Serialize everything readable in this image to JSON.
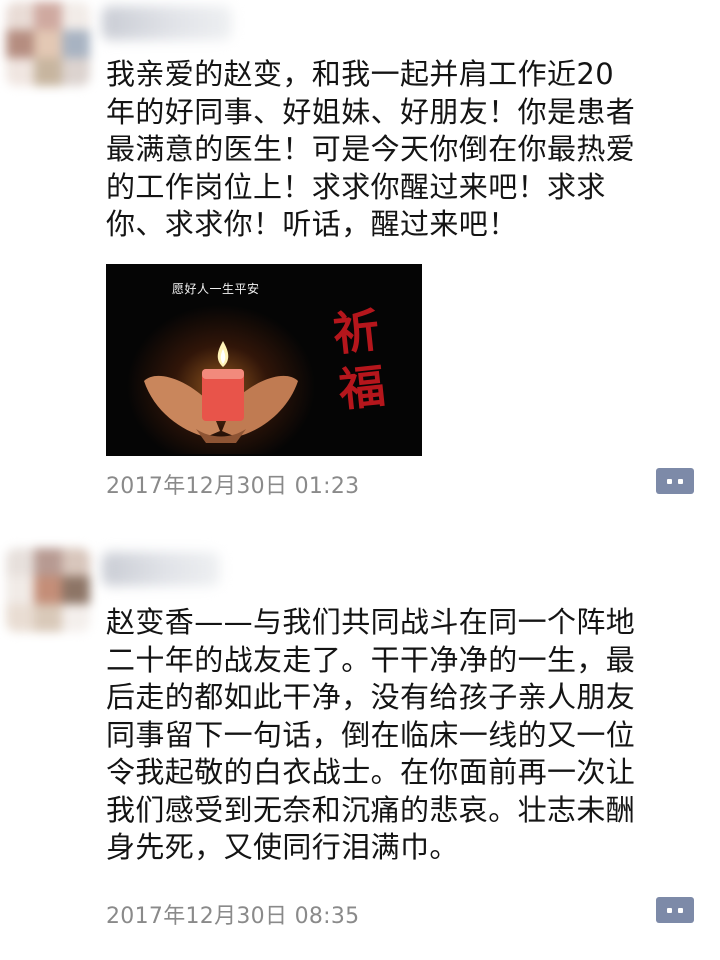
{
  "posts": [
    {
      "text": "我亲爱的赵变，和我一起并肩工作近20\n年的好同事、好姐妹、好朋友！你是患者\n最满意的医生！可是今天你倒在你最热爱\n的工作岗位上！求求你醒过来吧！求求\n你、求求你！听话，醒过来吧！",
      "image": {
        "caption": "愿好人一生平安",
        "blessing": "祈福",
        "icons": [
          "candle-icon",
          "hands-icon"
        ]
      },
      "timestamp": "2017年12月30日  01:23",
      "comment_icon": "comment-icon"
    },
    {
      "text": "赵变香——与我们共同战斗在同一个阵地\n二十年的战友走了。干干净净的一生，最\n后走的都如此干净，没有给孩子亲人朋友\n同事留下一句话，倒在临床一线的又一位\n令我起敬的白衣战士。在你面前再一次让\n我们感受到无奈和沉痛的悲哀。壮志未酬\n身先死，又使同行泪满巾。",
      "timestamp": "2017年12月30日  08:35",
      "comment_icon": "comment-icon"
    }
  ],
  "colors": {
    "text": "#141414",
    "timestamp": "#8a8a8a",
    "comment_button": "#7d8aa8",
    "blessing_red": "#b5161c"
  }
}
